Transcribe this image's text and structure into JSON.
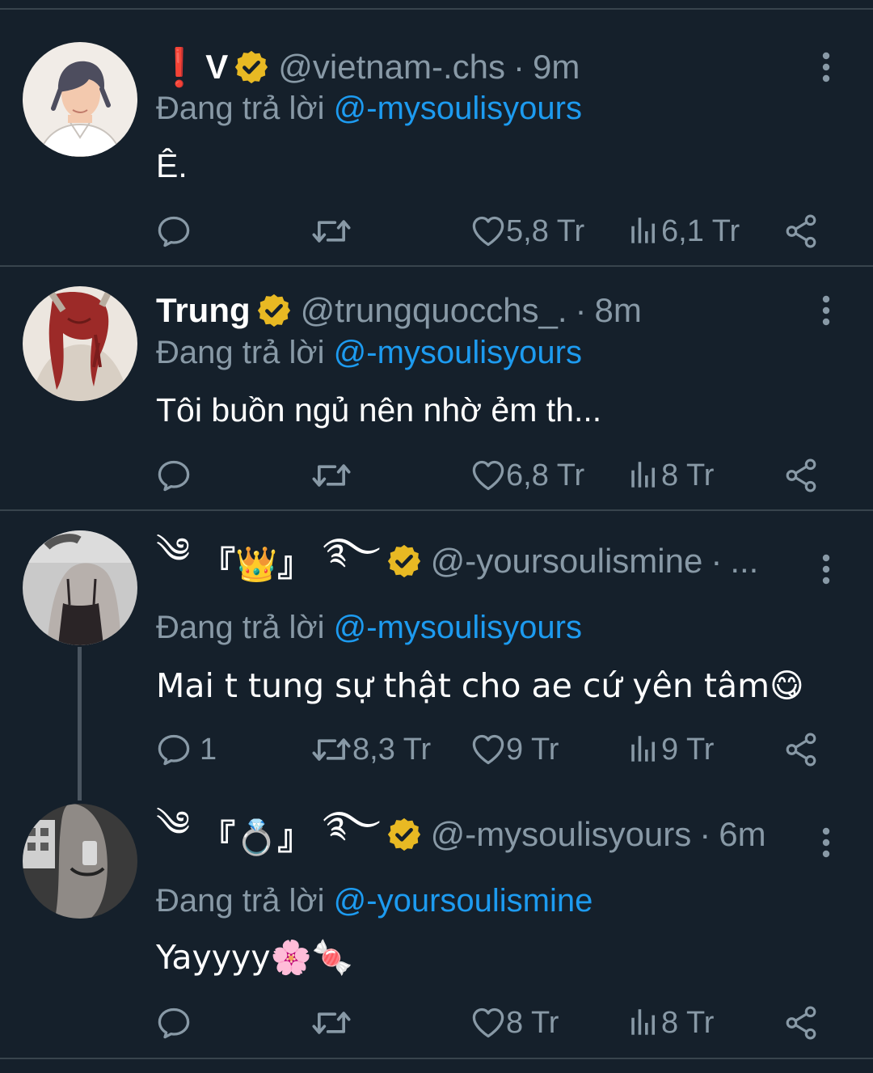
{
  "tweets": [
    {
      "display_name": "V",
      "prefix": "❗",
      "handle": "@vietnam-.chs",
      "dot": "·",
      "time": "9m",
      "reply_label": "Đang trả lời",
      "reply_to": "@-mysoulisyours",
      "text": "Ê.",
      "replies": "",
      "retweets": "",
      "likes": "5,8 Tr",
      "views": "6,1 Tr"
    },
    {
      "display_name": "Trung",
      "handle": "@trungquocchs_.",
      "dot": "·",
      "time": "8m",
      "reply_label": "Đang trả lời",
      "reply_to": "@-mysoulisyours",
      "text": "Tôi buồn ngủ nên nhờ ẻm th...",
      "replies": "",
      "retweets": "",
      "likes": "6,8 Tr",
      "views": "8 Tr"
    },
    {
      "name_left": "༄",
      "name_mid": "『👑』",
      "name_right": "࿐",
      "handle": "@-yoursoulismine",
      "dot": "·",
      "time": "...",
      "reply_label": "Đang trả lời",
      "reply_to": "@-mysoulisyours",
      "text": "Mai t tung sự thật cho ae cứ yên tâm😋",
      "replies": "1",
      "retweets": "8,3 Tr",
      "likes": "9 Tr",
      "views": "9 Tr"
    },
    {
      "name_left": "༄",
      "name_mid": "『💍』",
      "name_right": "࿐",
      "handle": "@-mysoulisyours",
      "dot": "·",
      "time": "6m",
      "reply_label": "Đang trả lời",
      "reply_to": "@-yoursoulismine",
      "text": "Yayyyy🌸🍬",
      "replies": "",
      "retweets": "",
      "likes": "8 Tr",
      "views": "8 Tr"
    }
  ],
  "icons": {
    "reply": "reply-icon",
    "retweet": "retweet-icon",
    "like": "heart-icon",
    "views": "views-icon",
    "share": "share-icon",
    "more": "more-icon",
    "verified": "verified-badge-icon"
  },
  "colors": {
    "background": "#15202b",
    "divider": "#38444d",
    "secondary_text": "#8899a6",
    "mention": "#1d9bf0",
    "verified": "#f4c430"
  }
}
